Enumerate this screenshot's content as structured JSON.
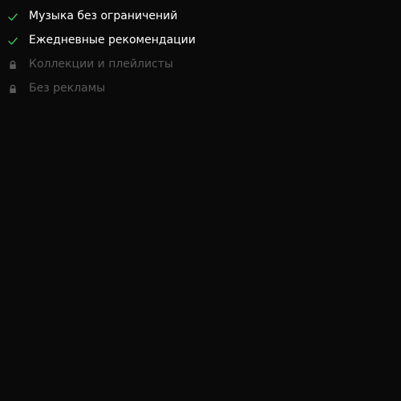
{
  "features": {
    "items": [
      {
        "label": "Музыка без ограничений",
        "status": "included",
        "icon": "check-icon"
      },
      {
        "label": "Ежедневные рекомендации",
        "status": "included",
        "icon": "check-icon"
      },
      {
        "label": "Коллекции и плейлисты",
        "status": "locked",
        "icon": "lock-icon"
      },
      {
        "label": "Без рекламы",
        "status": "locked",
        "icon": "lock-icon"
      }
    ]
  },
  "colors": {
    "background": "#0a0a0a",
    "included_text": "#ffffff",
    "locked_text": "#5a5a5a",
    "check_accent": "#3fc05a",
    "lock_icon": "#5a5a5a"
  }
}
